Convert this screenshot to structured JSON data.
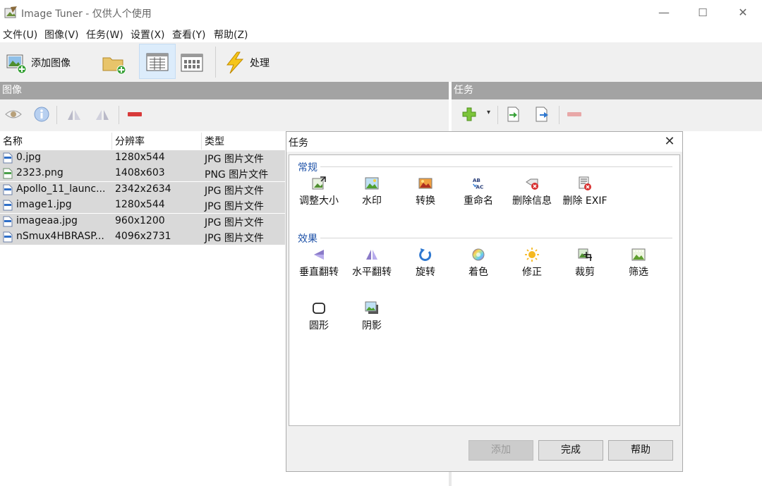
{
  "window": {
    "title": "Image Tuner - 仅供人个使用",
    "minimize_glyph": "—",
    "maximize_glyph": "☐",
    "close_glyph": "✕"
  },
  "menu": [
    "文件(U)",
    "图像(V)",
    "任务(W)",
    "设置(X)",
    "查看(Y)",
    "帮助(Z)"
  ],
  "toolbar": {
    "add_image_label": "添加图像",
    "process_label": "处理"
  },
  "panels": {
    "images_header": "图像",
    "tasks_header": "任务"
  },
  "file_list": {
    "columns": [
      "名称",
      "分辨率",
      "类型"
    ],
    "rows": [
      {
        "name": "0.jpg",
        "resolution": "1280x544",
        "type": "JPG 图片文件",
        "icon": "jpg-file-icon"
      },
      {
        "name": "2323.png",
        "resolution": "1408x603",
        "type": "PNG 图片文件",
        "icon": "png-file-icon"
      },
      {
        "name": "Apollo_11_launc...",
        "resolution": "2342x2634",
        "type": "JPG 图片文件",
        "icon": "jpg-file-icon"
      },
      {
        "name": "image1.jpg",
        "resolution": "1280x544",
        "type": "JPG 图片文件",
        "icon": "jpg-file-icon"
      },
      {
        "name": "imageaa.jpg",
        "resolution": "960x1200",
        "type": "JPG 图片文件",
        "icon": "jpg-file-icon"
      },
      {
        "name": "nSmux4HBRASP...",
        "resolution": "4096x2731",
        "type": "JPG 图片文件",
        "icon": "jpg-file-icon"
      }
    ]
  },
  "dialog": {
    "title": "任务",
    "group_general": "常规",
    "general_tasks": [
      {
        "label": "调整大小",
        "icon": "resize-icon"
      },
      {
        "label": "水印",
        "icon": "watermark-icon"
      },
      {
        "label": "转换",
        "icon": "convert-icon"
      },
      {
        "label": "重命名",
        "icon": "rename-icon"
      },
      {
        "label": "删除信息",
        "icon": "delete-info-icon"
      },
      {
        "label": "删除 EXIF",
        "icon": "delete-exif-icon"
      }
    ],
    "group_effects": "效果",
    "effect_tasks": [
      {
        "label": "垂直翻转",
        "icon": "flip-vertical-icon"
      },
      {
        "label": "水平翻转",
        "icon": "flip-horizontal-icon"
      },
      {
        "label": "旋转",
        "icon": "rotate-icon"
      },
      {
        "label": "着色",
        "icon": "colorize-icon"
      },
      {
        "label": "修正",
        "icon": "correct-icon"
      },
      {
        "label": "裁剪",
        "icon": "crop-icon"
      },
      {
        "label": "筛选",
        "icon": "filter-icon"
      },
      {
        "label": "圆形",
        "icon": "round-icon"
      },
      {
        "label": "阴影",
        "icon": "shadow-icon"
      }
    ],
    "buttons": {
      "add": "添加",
      "done": "完成",
      "help": "帮助"
    }
  },
  "colors": {
    "header_gray": "#a3a3a3",
    "toolbar_bg": "#f0f0f0",
    "selected_row": "#d9d9d9",
    "group_title_blue": "#1e52a8"
  }
}
